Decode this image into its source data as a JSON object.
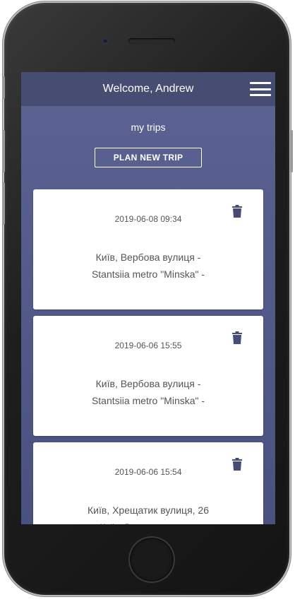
{
  "header": {
    "title": "Welcome, Andrew",
    "menu_icon": "hamburger-icon"
  },
  "page": {
    "section_title": "my trips",
    "plan_button": "PLAN NEW TRIP"
  },
  "trips": [
    {
      "date": "2019-06-08 09:34",
      "route_line1": "Київ, Вербова вулиця -",
      "route_line2": "Stantsiia metro \"Minska\" -"
    },
    {
      "date": "2019-06-06 15:55",
      "route_line1": "Київ, Вербова вулиця -",
      "route_line2": "Stantsiia metro \"Minska\" -"
    },
    {
      "date": "2019-06-06 15:54",
      "route_line1": "Київ, Хрещатик вулиця, 26",
      "route_line2": "Київ, Володимирська"
    }
  ],
  "colors": {
    "header_bg": "#464c72",
    "body_bg": "#5c6393",
    "trash_icon": "#464c72"
  }
}
